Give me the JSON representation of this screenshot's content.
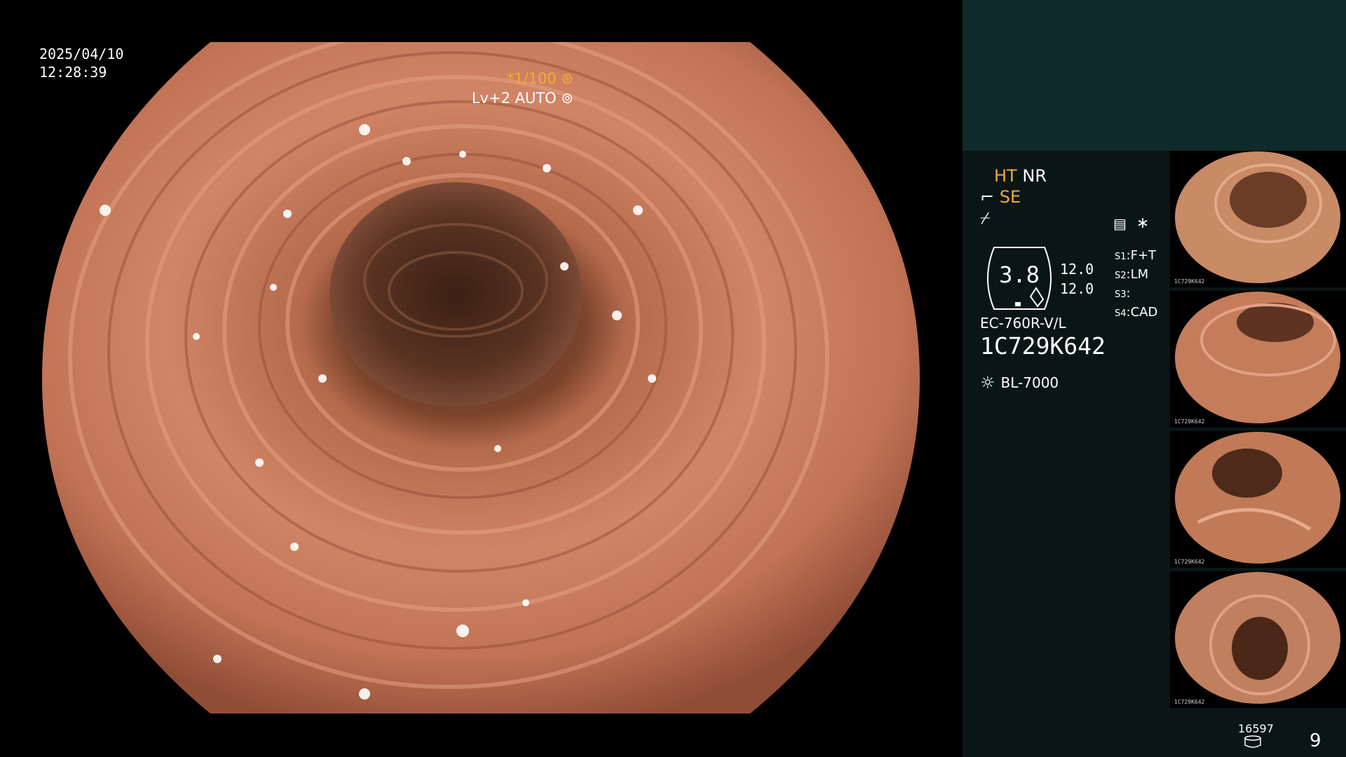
{
  "overlay": {
    "date": "2025/04/10",
    "time": "12:28:39",
    "shutter": "*1/100",
    "level": "Lv+2 AUTO"
  },
  "status": {
    "ht": "HT",
    "nr": "NR",
    "se": "SE",
    "gauge_value": "3.8",
    "exposure_top": "12.0",
    "exposure_bottom": "12.0",
    "s_slots": [
      {
        "key": "S1",
        "value": "F+T"
      },
      {
        "key": "S2",
        "value": "LM"
      },
      {
        "key": "S3",
        "value": ""
      },
      {
        "key": "S4",
        "value": "CAD"
      }
    ],
    "model": "EC-760R-V/L",
    "serial": "1C729K642",
    "light_source": "BL-7000"
  },
  "thumbnails": [
    {
      "caption": "1C729K642"
    },
    {
      "caption": "1C729K642"
    },
    {
      "caption": "1C729K642"
    },
    {
      "caption": "1C729K642"
    }
  ],
  "footer": {
    "image_count": "16597",
    "page": "9"
  },
  "icons": {
    "shutter_icon": "aperture-icon",
    "auto_icon": "iris-icon",
    "menu_icon": "menu-list-icon",
    "star_icon": "asterisk-icon",
    "light_icon": "sun-icon",
    "db_icon": "storage-icon"
  },
  "colors": {
    "accent": "#f2a93b",
    "panel_bg": "#0a1616",
    "panel_top": "#0f2a2a",
    "tissue": "#c87a5c"
  }
}
